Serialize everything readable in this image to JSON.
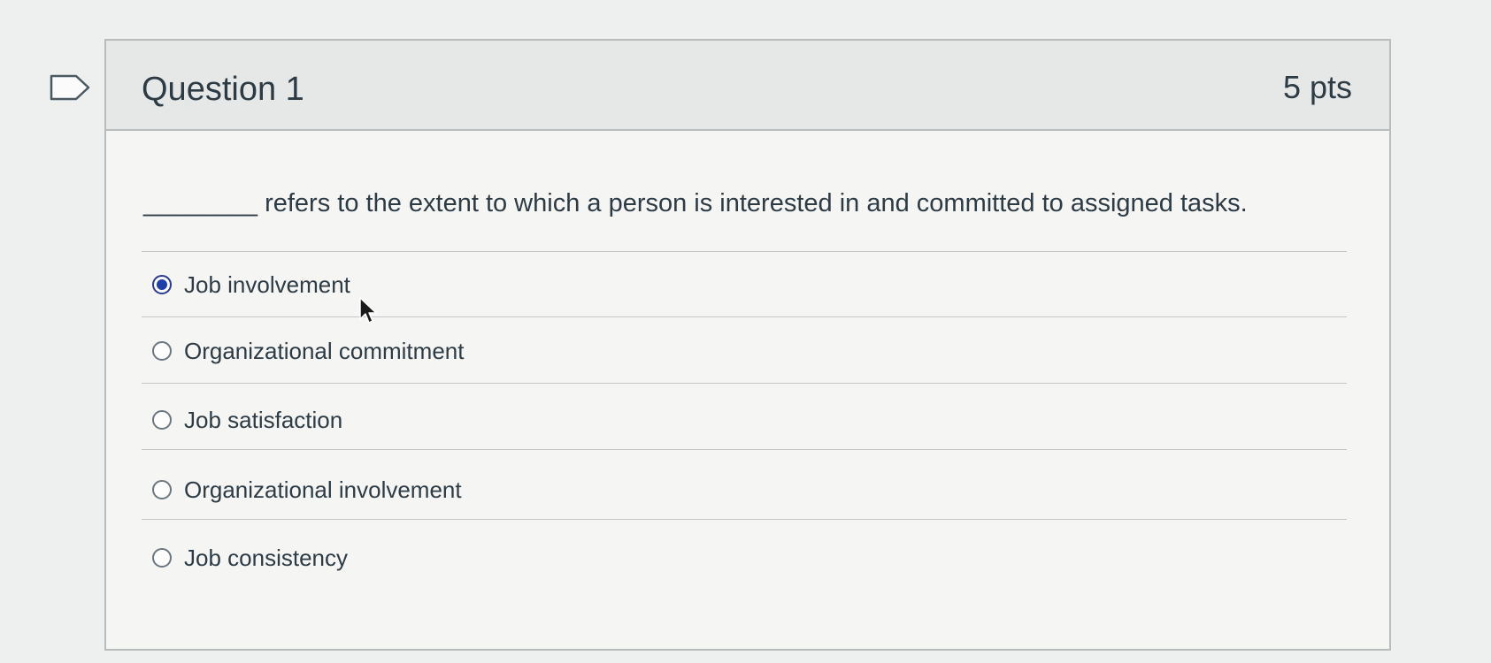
{
  "question": {
    "title": "Question 1",
    "points": "5 pts",
    "prompt": "________ refers to the extent to which a person is interested in and committed to assigned tasks."
  },
  "answers": [
    {
      "label": "Job involvement",
      "selected": true
    },
    {
      "label": "Organizational commitment",
      "selected": false
    },
    {
      "label": "Job satisfaction",
      "selected": false
    },
    {
      "label": "Organizational involvement",
      "selected": false
    },
    {
      "label": "Job consistency",
      "selected": false
    }
  ],
  "colors": {
    "selected_radio": "#1f3fa8",
    "header_bg": "#e6e8e7",
    "text": "#2d3b45"
  },
  "icons": {
    "flag": "flag-question-icon",
    "cursor": "mouse-pointer-icon"
  }
}
